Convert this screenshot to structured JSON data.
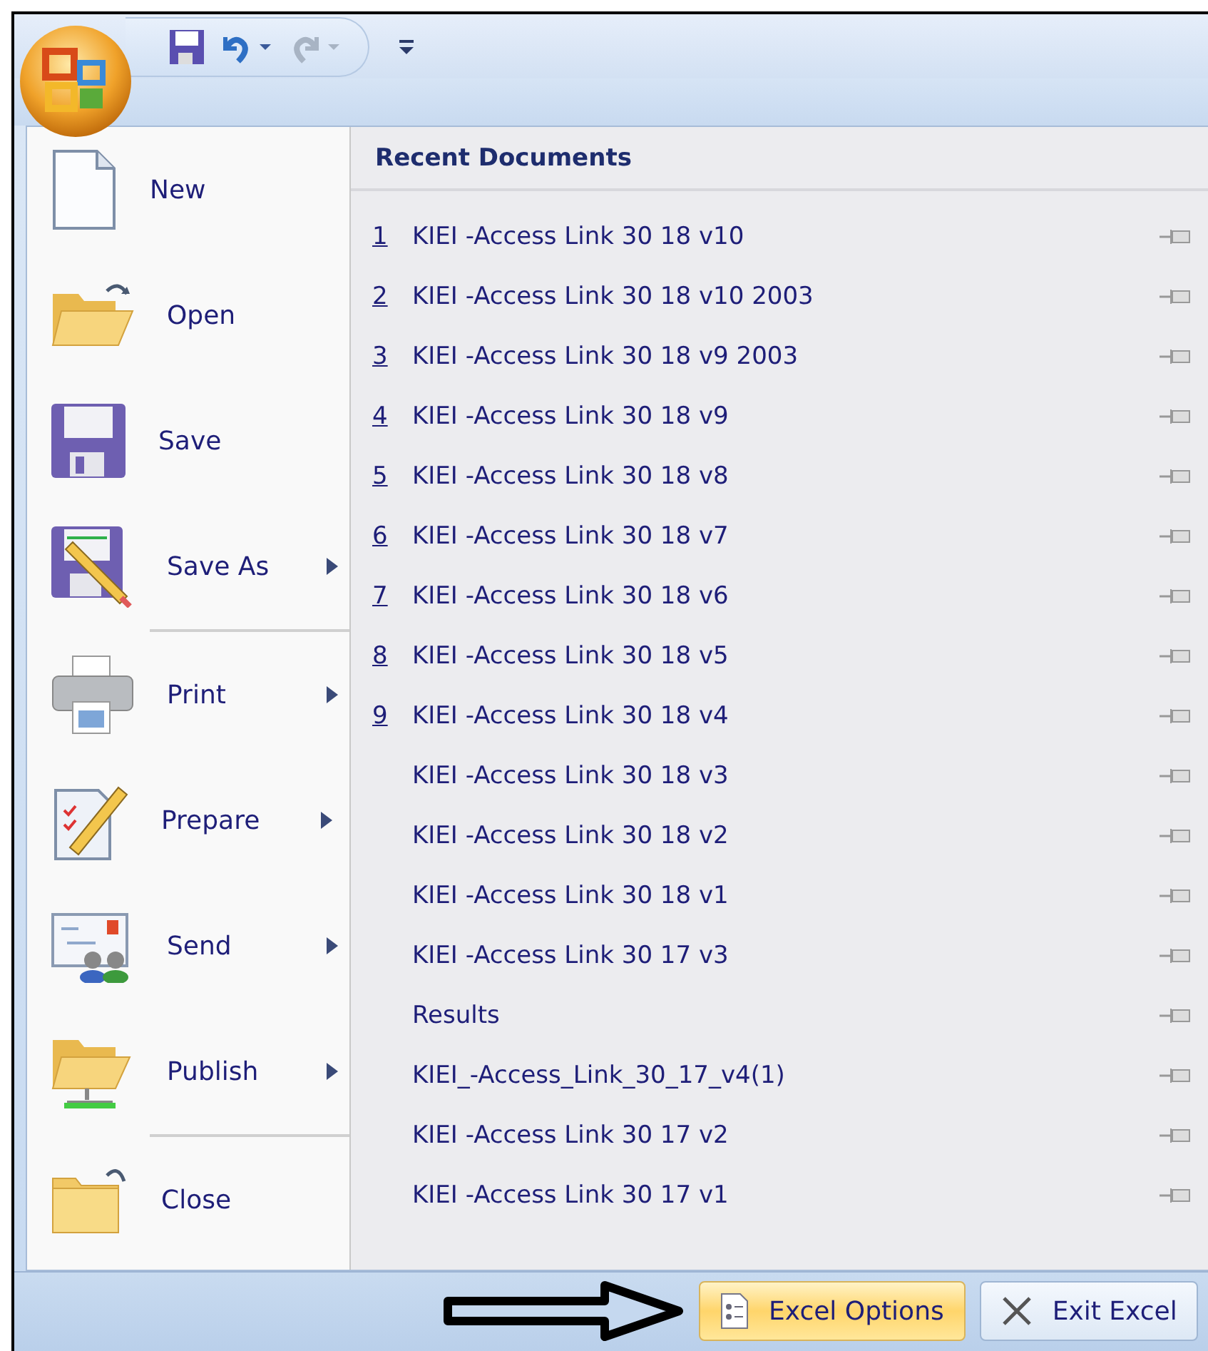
{
  "menu": {
    "groups": [
      [
        {
          "label": "New",
          "submenu": false
        },
        {
          "label": "Open",
          "submenu": false
        },
        {
          "label": "Save",
          "submenu": false
        },
        {
          "label": "Save As",
          "submenu": true
        }
      ],
      [
        {
          "label": "Print",
          "submenu": true
        },
        {
          "label": "Prepare",
          "submenu": true
        },
        {
          "label": "Send",
          "submenu": true
        },
        {
          "label": "Publish",
          "submenu": true
        }
      ],
      [
        {
          "label": "Close",
          "submenu": false
        }
      ]
    ]
  },
  "recent_documents": {
    "title": "Recent Documents",
    "items": [
      {
        "number": "1",
        "name": "KIEI -Access Link 30 18 v10"
      },
      {
        "number": "2",
        "name": "KIEI -Access Link 30 18 v10 2003"
      },
      {
        "number": "3",
        "name": "KIEI -Access Link 30 18 v9 2003"
      },
      {
        "number": "4",
        "name": "KIEI -Access Link 30 18 v9"
      },
      {
        "number": "5",
        "name": "KIEI -Access Link 30 18 v8"
      },
      {
        "number": "6",
        "name": "KIEI -Access Link 30 18 v7"
      },
      {
        "number": "7",
        "name": "KIEI -Access Link 30 18 v6"
      },
      {
        "number": "8",
        "name": "KIEI -Access Link 30 18 v5"
      },
      {
        "number": "9",
        "name": "KIEI -Access Link 30 18 v4"
      },
      {
        "name": "KIEI -Access Link 30 18 v3"
      },
      {
        "name": "KIEI -Access Link 30 18 v2"
      },
      {
        "name": "KIEI -Access Link 30 18 v1"
      },
      {
        "name": "KIEI -Access Link 30 17 v3"
      },
      {
        "name": "Results"
      },
      {
        "name": "KIEI_-Access_Link_30_17_v4(1)"
      },
      {
        "name": "KIEI -Access Link 30 17 v2"
      },
      {
        "name": "KIEI -Access Link 30 17 v1"
      }
    ]
  },
  "footer_buttons": [
    {
      "label": "Excel Options",
      "kind": "options"
    },
    {
      "label": "Exit Excel",
      "kind": "exit"
    }
  ]
}
